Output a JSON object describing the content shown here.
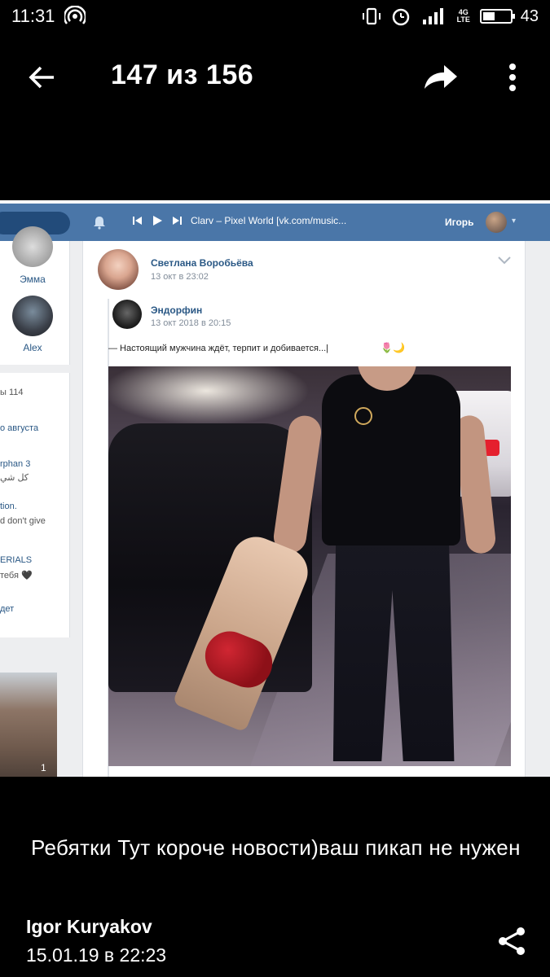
{
  "status_bar": {
    "time": "11:31",
    "network": "4G LTE",
    "battery_level": "43",
    "battery_fraction": 0.43
  },
  "header": {
    "counter": "147 из 156",
    "icons": [
      "back-arrow-icon",
      "share-forward-icon",
      "more-vertical-icon"
    ]
  },
  "screenshot": {
    "topbar": {
      "track": "Clarv – Pixel World [vk.com/music...",
      "user": "Игорь",
      "color": "#4a76a8"
    },
    "friends": [
      {
        "name": "Эмма"
      },
      {
        "name": "Alex"
      }
    ],
    "left_snippets": [
      {
        "text": "ы 114"
      },
      {
        "text": "о августа"
      },
      {
        "text": "rphan 3"
      },
      {
        "text": "كل شي"
      },
      {
        "text": "tion."
      },
      {
        "text": "d don't give"
      },
      {
        "text": "ERIALS"
      },
      {
        "text": "тебя 🖤"
      },
      {
        "text": "дет"
      }
    ],
    "left_photo_count": "1",
    "post": {
      "author": "Светлана Воробьёва",
      "date": "13 окт в 23:02",
      "repost_author": "Эндорфин",
      "repost_date": "13 окт 2018 в 20:15",
      "repost_text": "— Настоящий мужчина ждёт, терпит и добивается...|",
      "repost_emoji": "🌷🌙"
    }
  },
  "caption": "Ребятки Тут короче новости)ваш пикап не нужен",
  "author": "Igor Kuryakov",
  "date": "15.01.19 в 22:23"
}
